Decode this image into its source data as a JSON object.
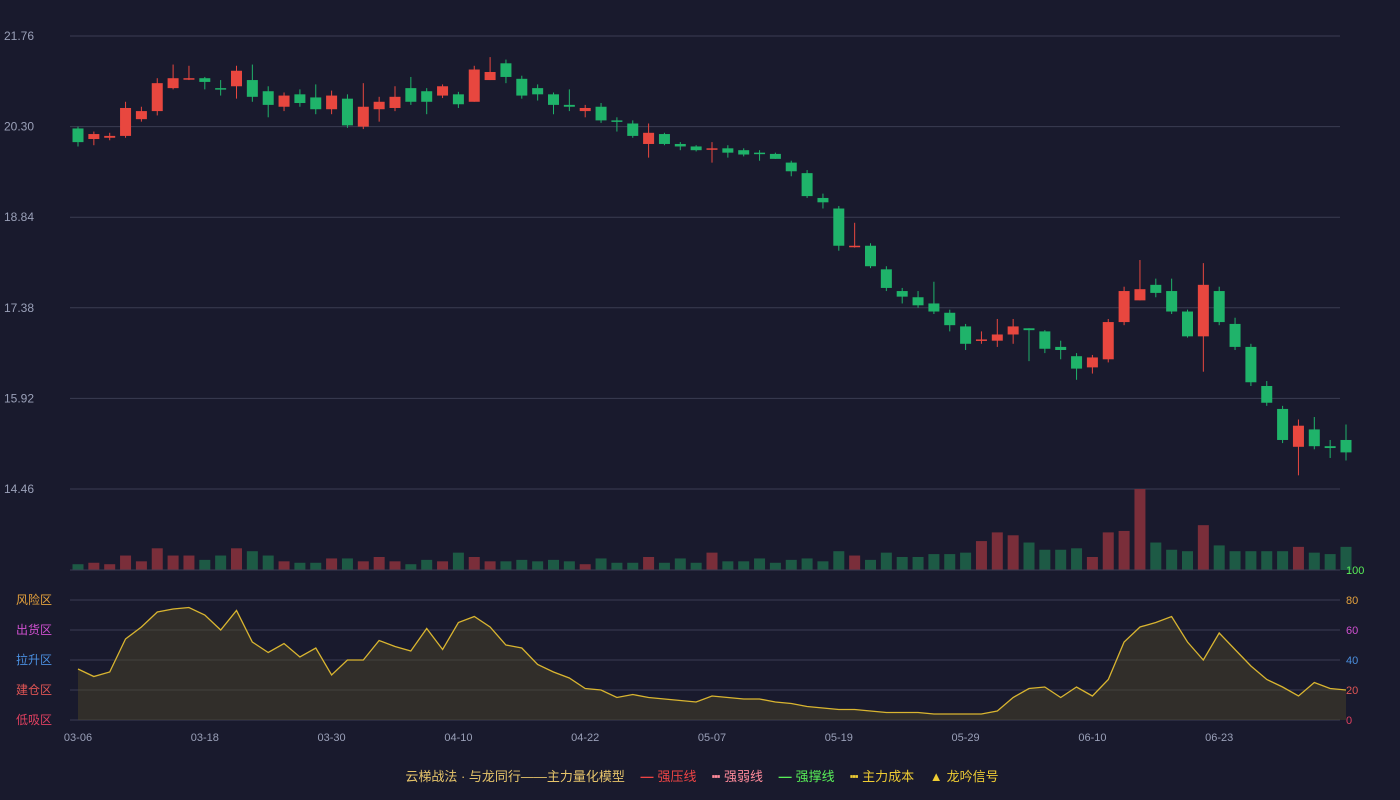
{
  "chart_data": {
    "type": "candlestick",
    "price_ticks": [
      "21.76",
      "20.30",
      "18.84",
      "17.38",
      "15.92",
      "14.46"
    ],
    "ylim": [
      14.46,
      21.76
    ],
    "x_labels": [
      "03-06",
      "03-18",
      "03-30",
      "04-10",
      "04-22",
      "05-07",
      "05-19",
      "05-29",
      "06-10",
      "06-23"
    ],
    "candles": [
      [
        20.27,
        20.05,
        20.3,
        19.98
      ],
      [
        20.1,
        20.18,
        20.22,
        20.0
      ],
      [
        20.12,
        20.15,
        20.2,
        20.08
      ],
      [
        20.15,
        20.6,
        20.7,
        20.12
      ],
      [
        20.42,
        20.55,
        20.62,
        20.38
      ],
      [
        20.55,
        21.0,
        21.08,
        20.48
      ],
      [
        20.92,
        21.08,
        21.3,
        20.9
      ],
      [
        21.08,
        21.08,
        21.28,
        21.05
      ],
      [
        21.08,
        21.02,
        21.1,
        20.9
      ],
      [
        20.92,
        20.9,
        21.05,
        20.8
      ],
      [
        20.95,
        21.2,
        21.28,
        20.75
      ],
      [
        21.05,
        20.78,
        21.3,
        20.7
      ],
      [
        20.87,
        20.65,
        20.95,
        20.45
      ],
      [
        20.62,
        20.8,
        20.85,
        20.55
      ],
      [
        20.82,
        20.68,
        20.9,
        20.62
      ],
      [
        20.77,
        20.58,
        20.98,
        20.5
      ],
      [
        20.58,
        20.8,
        20.88,
        20.5
      ],
      [
        20.75,
        20.32,
        20.82,
        20.28
      ],
      [
        20.3,
        20.62,
        21.0,
        20.26
      ],
      [
        20.58,
        20.7,
        20.78,
        20.38
      ],
      [
        20.6,
        20.78,
        20.95,
        20.55
      ],
      [
        20.92,
        20.7,
        21.1,
        20.65
      ],
      [
        20.87,
        20.7,
        20.92,
        20.5
      ],
      [
        20.8,
        20.95,
        20.98,
        20.76
      ],
      [
        20.82,
        20.66,
        20.86,
        20.6
      ],
      [
        20.7,
        21.22,
        21.28,
        20.7
      ],
      [
        21.05,
        21.18,
        21.42,
        21.05
      ],
      [
        21.32,
        21.1,
        21.38,
        21.0
      ],
      [
        21.07,
        20.8,
        21.12,
        20.75
      ],
      [
        20.92,
        20.82,
        20.98,
        20.72
      ],
      [
        20.82,
        20.65,
        20.85,
        20.5
      ],
      [
        20.65,
        20.62,
        20.9,
        20.55
      ],
      [
        20.55,
        20.6,
        20.65,
        20.45
      ],
      [
        20.62,
        20.4,
        20.68,
        20.36
      ],
      [
        20.4,
        20.38,
        20.45,
        20.22
      ],
      [
        20.35,
        20.15,
        20.4,
        20.12
      ],
      [
        20.02,
        20.2,
        20.35,
        19.8
      ],
      [
        20.18,
        20.02,
        20.2,
        20.0
      ],
      [
        20.02,
        19.98,
        20.05,
        19.92
      ],
      [
        19.98,
        19.92,
        20.0,
        19.9
      ],
      [
        19.95,
        19.95,
        20.05,
        19.72
      ],
      [
        19.95,
        19.88,
        20.0,
        19.8
      ],
      [
        19.92,
        19.85,
        19.95,
        19.82
      ],
      [
        19.88,
        19.86,
        19.92,
        19.75
      ],
      [
        19.86,
        19.78,
        19.88,
        19.78
      ],
      [
        19.72,
        19.58,
        19.75,
        19.5
      ],
      [
        19.55,
        19.18,
        19.6,
        19.15
      ],
      [
        19.15,
        19.08,
        19.22,
        18.98
      ],
      [
        18.98,
        18.38,
        19.02,
        18.3
      ],
      [
        18.38,
        18.38,
        18.75,
        18.35
      ],
      [
        18.38,
        18.05,
        18.42,
        18.02
      ],
      [
        18.0,
        17.7,
        18.05,
        17.65
      ],
      [
        17.65,
        17.56,
        17.7,
        17.45
      ],
      [
        17.55,
        17.42,
        17.65,
        17.38
      ],
      [
        17.45,
        17.32,
        17.8,
        17.28
      ],
      [
        17.3,
        17.1,
        17.35,
        17.0
      ],
      [
        17.08,
        16.8,
        17.12,
        16.7
      ],
      [
        16.87,
        16.87,
        17.0,
        16.8
      ],
      [
        16.85,
        16.95,
        17.2,
        16.75
      ],
      [
        16.95,
        17.08,
        17.2,
        16.8
      ],
      [
        17.05,
        17.02,
        17.05,
        16.52
      ],
      [
        17.0,
        16.72,
        17.02,
        16.65
      ],
      [
        16.75,
        16.7,
        16.85,
        16.55
      ],
      [
        16.6,
        16.4,
        16.65,
        16.22
      ],
      [
        16.42,
        16.58,
        16.62,
        16.32
      ],
      [
        16.55,
        17.15,
        17.2,
        16.5
      ],
      [
        17.15,
        17.65,
        17.72,
        17.1
      ],
      [
        17.5,
        17.68,
        18.15,
        17.5
      ],
      [
        17.75,
        17.62,
        17.85,
        17.55
      ],
      [
        17.65,
        17.32,
        17.85,
        17.28
      ],
      [
        17.32,
        16.92,
        17.35,
        16.9
      ],
      [
        16.92,
        17.75,
        18.1,
        16.35
      ],
      [
        17.65,
        17.15,
        17.72,
        17.1
      ],
      [
        17.12,
        16.75,
        17.22,
        16.7
      ],
      [
        16.75,
        16.18,
        16.8,
        16.12
      ],
      [
        16.12,
        15.85,
        16.2,
        15.8
      ],
      [
        15.75,
        15.25,
        15.8,
        15.2
      ],
      [
        15.14,
        15.48,
        15.58,
        14.68
      ],
      [
        15.42,
        15.15,
        15.62,
        15.1
      ],
      [
        15.15,
        15.12,
        15.25,
        14.96
      ],
      [
        15.25,
        15.05,
        15.5,
        14.92
      ]
    ],
    "volume_ticks": [
      "100"
    ],
    "volumes": [
      4,
      5,
      4,
      10,
      6,
      15,
      10,
      10,
      7,
      10,
      15,
      13,
      10,
      6,
      5,
      5,
      8,
      8,
      6,
      9,
      6,
      4,
      7,
      6,
      12,
      9,
      6,
      6,
      7,
      6,
      7,
      6,
      4,
      8,
      5,
      5,
      9,
      5,
      8,
      5,
      12,
      6,
      6,
      8,
      5,
      7,
      8,
      6,
      13,
      10,
      7,
      12,
      9,
      9,
      11,
      11,
      12,
      20,
      26,
      24,
      19,
      14,
      14,
      15,
      9,
      26,
      27,
      56,
      19,
      14,
      13,
      31,
      17,
      13,
      13,
      13,
      13,
      16,
      12,
      11,
      16
    ],
    "indicator_ticks": [
      "80",
      "60",
      "40",
      "20",
      "0"
    ],
    "indicator_ylim": [
      0,
      100
    ],
    "zones": [
      "风险区",
      "出货区",
      "拉升区",
      "建仓区",
      "低吸区"
    ],
    "zone_colors": [
      "#e6a23c",
      "#d050d0",
      "#4a8fe0",
      "#e05555",
      "#e04060"
    ],
    "indicator": [
      34,
      29,
      32,
      54,
      62,
      72,
      74,
      75,
      70,
      60,
      73,
      52,
      45,
      51,
      42,
      48,
      30,
      40,
      40,
      53,
      49,
      46,
      61,
      47,
      65,
      69,
      62,
      50,
      48,
      37,
      32,
      28,
      21,
      20,
      15,
      17,
      15,
      14,
      13,
      12,
      16,
      15,
      14,
      14,
      12,
      11,
      9,
      8,
      7,
      7,
      6,
      5,
      5,
      5,
      4,
      4,
      4,
      4,
      6,
      15,
      21,
      22,
      15,
      22,
      16,
      27,
      52,
      62,
      65,
      69,
      52,
      40,
      58,
      47,
      36,
      27,
      22,
      16,
      25,
      21,
      20
    ]
  },
  "legend": {
    "items": [
      {
        "label": "云梯战法 · 与龙同行——主力量化模型",
        "mark": "",
        "color": "#e6c46a"
      },
      {
        "label": "强压线",
        "mark": "—",
        "color": "#ee4444"
      },
      {
        "label": "强弱线",
        "mark": "┅",
        "color": "#ff8a9a"
      },
      {
        "label": "强撑线",
        "mark": "—",
        "color": "#58ee58"
      },
      {
        "label": "主力成本",
        "mark": "┅",
        "color": "#eecc33"
      },
      {
        "label": "龙吟信号",
        "mark": "▲",
        "color": "#eecc33"
      }
    ]
  },
  "colors": {
    "up": "#e8473f",
    "down": "#1fb36a",
    "grid": "#3a3c52",
    "axis_text": "#9aa0b8",
    "line": "#d9b530"
  }
}
